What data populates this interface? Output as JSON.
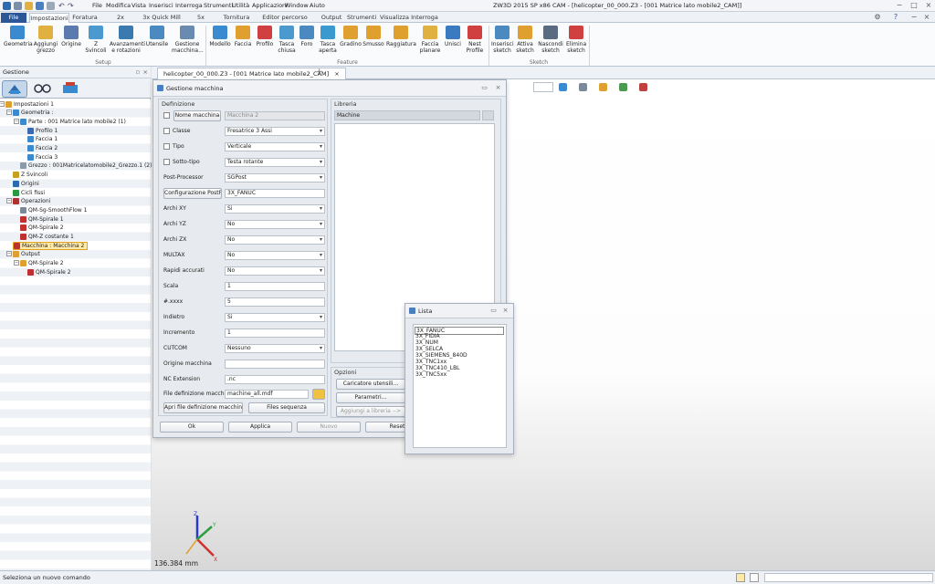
{
  "app": {
    "window_title": "ZW3D 2015 SP x86        CAM - [helicopter_00_000.Z3 - [001 Matrice lato mobile2_CAM]]"
  },
  "menubar": [
    "File",
    "Modifica",
    "Vista",
    "Inserisci",
    "Interroga",
    "Strumenti",
    "Utilità",
    "Applicazioni",
    "Window",
    "Aiuto"
  ],
  "ribbon_tabs": [
    "File",
    "Impostazioni",
    "Foratura",
    "2x Fresatura",
    "3x Quick Mill",
    "5x Fresatura",
    "Tornitura",
    "Editor percorso utensile",
    "Output",
    "Strumenti",
    "Visualizza",
    "Interroga"
  ],
  "ribbon": {
    "setup": [
      "Geometria",
      "Aggiungi grezzo",
      "Origine",
      "Z Svincoli",
      "Avanzamenti e rotazioni",
      "Utensile",
      "Gestione macchina..."
    ],
    "feature": [
      "Modello",
      "Faccia",
      "Profilo",
      "Tasca chiusa",
      "Foro",
      "Tasca aperta",
      "Gradino",
      "Smusso",
      "Raggiatura",
      "Faccia planare",
      "Unisci",
      "Nest Profile"
    ],
    "sketch": [
      "Inserisci sketch",
      "Attiva sketch",
      "Nascondi sketch",
      "Elimina sketch"
    ],
    "groups": [
      "Setup",
      "Feature",
      "Sketch"
    ]
  },
  "left_panel": {
    "title": "Gestione",
    "tree": [
      {
        "label": "Impostazioni 1",
        "indent": 0,
        "icon": "folder-icon",
        "color": "#e0a030"
      },
      {
        "label": "Geometria :",
        "indent": 1,
        "icon": "geometry-icon",
        "color": "#3a8ad0"
      },
      {
        "label": "Parte : 001 Matrice lato mobile2 (1)",
        "indent": 2,
        "icon": "part-icon",
        "color": "#3a8ad0"
      },
      {
        "label": "Profilo 1",
        "indent": 3,
        "icon": "profile-icon",
        "color": "#3a6ab0"
      },
      {
        "label": "Faccia 1",
        "indent": 3,
        "icon": "face-icon",
        "color": "#3a8ad0"
      },
      {
        "label": "Faccia 2",
        "indent": 3,
        "icon": "face-icon",
        "color": "#3a8ad0"
      },
      {
        "label": "Faccia 3",
        "indent": 3,
        "icon": "face-icon",
        "color": "#3a8ad0"
      },
      {
        "label": "Grezzo : 001Matricelatomobile2_Grezzo.1 (2)",
        "indent": 2,
        "icon": "stock-icon",
        "color": "#8a9aa8"
      },
      {
        "label": "Z Svincoli",
        "indent": 1,
        "icon": "z-clearance-icon",
        "color": "#c8a020"
      },
      {
        "label": "Origini",
        "indent": 1,
        "icon": "origin-icon",
        "color": "#2a6ab0"
      },
      {
        "label": "Cicli fissi",
        "indent": 1,
        "icon": "fixed-cycles-icon",
        "color": "#2a9a40"
      },
      {
        "label": "Operazioni",
        "indent": 1,
        "icon": "operations-icon",
        "color": "#b03030"
      },
      {
        "label": "QM-Sg-SmoothFlow 1",
        "indent": 2,
        "icon": "operation-icon",
        "color": "#7a8898"
      },
      {
        "label": "QM-Spirale 1",
        "indent": 2,
        "icon": "operation-icon",
        "color": "#c03030"
      },
      {
        "label": "QM-Spirale 2",
        "indent": 2,
        "icon": "operation-icon",
        "color": "#c03030"
      },
      {
        "label": "QM-Z costante 1",
        "indent": 2,
        "icon": "operation-icon",
        "color": "#c03030"
      },
      {
        "label": "Macchina : Macchina 2",
        "indent": 1,
        "icon": "machine-icon",
        "color": "#c03030",
        "selected": true
      },
      {
        "label": "Output",
        "indent": 1,
        "icon": "output-icon",
        "color": "#e0a030"
      },
      {
        "label": "QM-Spirale 2",
        "indent": 2,
        "icon": "output-item-icon",
        "color": "#e0a030"
      },
      {
        "label": "QM-Spirale 2",
        "indent": 3,
        "icon": "operation-icon",
        "color": "#c03030"
      }
    ]
  },
  "doc_tab": "helicopter_00_000.Z3 - [001 Matrice lato mobile2_CAM]",
  "dialog": {
    "title": "Gestione macchina",
    "definizione_title": "Definizione",
    "nome_macchina_btn": "Nome macchina",
    "nome_macchina_val": "Macchina 2",
    "fields": [
      {
        "label": "Classe",
        "value": "Fresatrice 3 Assi",
        "type": "dropdown",
        "checkbox": true
      },
      {
        "label": "Tipo",
        "value": "Verticale",
        "type": "dropdown",
        "checkbox": true
      },
      {
        "label": "Sotto-tipo",
        "value": "Testa rotante",
        "type": "dropdown",
        "checkbox": true
      },
      {
        "label": "Post-Processor",
        "value": "SGPost",
        "type": "dropdown"
      },
      {
        "label": "Configurazione PostP",
        "value": "3X_FANUC",
        "type": "button"
      },
      {
        "label": "Archi XY",
        "value": "Si",
        "type": "dropdown"
      },
      {
        "label": "Archi YZ",
        "value": "No",
        "type": "dropdown"
      },
      {
        "label": "Archi ZX",
        "value": "No",
        "type": "dropdown"
      },
      {
        "label": "MULTAX",
        "value": "No",
        "type": "dropdown"
      },
      {
        "label": "Rapidi accurati",
        "value": "No",
        "type": "dropdown"
      },
      {
        "label": "Scala",
        "value": "1",
        "type": "text"
      },
      {
        "label": "#.xxxx",
        "value": "5",
        "type": "text"
      },
      {
        "label": "Indietro",
        "value": "Si",
        "type": "dropdown"
      },
      {
        "label": "Incremento",
        "value": "1",
        "type": "text"
      },
      {
        "label": "CUTCOM",
        "value": "Nessuno",
        "type": "dropdown"
      },
      {
        "label": "Origine macchina",
        "value": "",
        "type": "text"
      },
      {
        "label": "NC Extension",
        "value": ".nc",
        "type": "text"
      },
      {
        "label": "File definizione macchina",
        "value": "machine_all.mdf",
        "type": "file"
      }
    ],
    "apri_btn": "Apri file definizione macchina",
    "files_btn": "Files sequenza",
    "libreria_title": "Libreria",
    "libreria_header": "Machine",
    "opzioni_title": "Opzioni",
    "caricatore_btn": "Caricatore utensili...",
    "parametri_btn": "Parametri...",
    "aggiungi_btn": "Aggiungi a libreria -->",
    "ok_btn": "Ok",
    "applica_btn": "Applica",
    "nuovo_btn": "Nuovo",
    "reset_btn": "Reset"
  },
  "lista": {
    "title": "Lista",
    "items": [
      "3X_FANUC",
      "3X_FIDIA",
      "3X_NUM",
      "3X_SELCA",
      "3X_SIEMENS_840D",
      "3X_TNC1xx",
      "3X_TNC410_LBL",
      "3X_TNC5xx"
    ]
  },
  "viewport": {
    "coord": "136.384 mm"
  },
  "status": {
    "text": "Seleziona un nuovo comando"
  }
}
